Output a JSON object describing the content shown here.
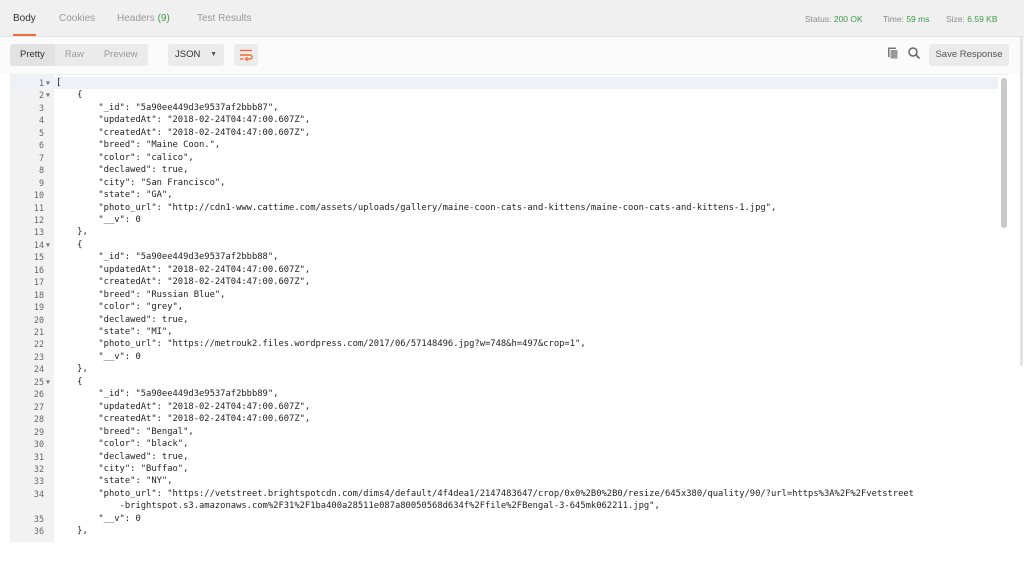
{
  "tabs": [
    {
      "label": "Body",
      "active": true
    },
    {
      "label": "Cookies",
      "active": false
    },
    {
      "label": "Headers",
      "count": "(9)",
      "active": false
    },
    {
      "label": "Test Results",
      "active": false
    }
  ],
  "status": {
    "status_label": "Status:",
    "status_value": "200 OK",
    "time_label": "Time:",
    "time_value": "59 ms",
    "size_label": "Size:",
    "size_value": "6.59 KB",
    "value_color": "#3f9b48"
  },
  "toolbar": {
    "view_modes": [
      "Pretty",
      "Raw",
      "Preview"
    ],
    "active_mode": "Pretty",
    "format_select": "JSON",
    "save_response_label": "Save Response",
    "accent_color": "#f26b3a"
  },
  "code_lines": [
    {
      "n": "1",
      "fold": true,
      "text": "["
    },
    {
      "n": "2",
      "fold": true,
      "text": "    {"
    },
    {
      "n": "3",
      "text": "        \"_id\": \"5a90ee449d3e9537af2bbb87\","
    },
    {
      "n": "4",
      "text": "        \"updatedAt\": \"2018-02-24T04:47:00.607Z\","
    },
    {
      "n": "5",
      "text": "        \"createdAt\": \"2018-02-24T04:47:00.607Z\","
    },
    {
      "n": "6",
      "text": "        \"breed\": \"Maine Coon.\","
    },
    {
      "n": "7",
      "text": "        \"color\": \"calico\","
    },
    {
      "n": "8",
      "text": "        \"declawed\": true,"
    },
    {
      "n": "9",
      "text": "        \"city\": \"San Francisco\","
    },
    {
      "n": "10",
      "text": "        \"state\": \"GA\","
    },
    {
      "n": "11",
      "text": "        \"photo_url\": \"http://cdn1-www.cattime.com/assets/uploads/gallery/maine-coon-cats-and-kittens/maine-coon-cats-and-kittens-1.jpg\","
    },
    {
      "n": "12",
      "text": "        \"__v\": 0"
    },
    {
      "n": "13",
      "text": "    },"
    },
    {
      "n": "14",
      "fold": true,
      "text": "    {"
    },
    {
      "n": "15",
      "text": "        \"_id\": \"5a90ee449d3e9537af2bbb88\","
    },
    {
      "n": "16",
      "text": "        \"updatedAt\": \"2018-02-24T04:47:00.607Z\","
    },
    {
      "n": "17",
      "text": "        \"createdAt\": \"2018-02-24T04:47:00.607Z\","
    },
    {
      "n": "18",
      "text": "        \"breed\": \"Russian Blue\","
    },
    {
      "n": "19",
      "text": "        \"color\": \"grey\","
    },
    {
      "n": "20",
      "text": "        \"declawed\": true,"
    },
    {
      "n": "21",
      "text": "        \"state\": \"MI\","
    },
    {
      "n": "22",
      "text": "        \"photo_url\": \"https://metrouk2.files.wordpress.com/2017/06/57148496.jpg?w=748&h=497&crop=1\","
    },
    {
      "n": "23",
      "text": "        \"__v\": 0"
    },
    {
      "n": "24",
      "text": "    },"
    },
    {
      "n": "25",
      "fold": true,
      "text": "    {"
    },
    {
      "n": "26",
      "text": "        \"_id\": \"5a90ee449d3e9537af2bbb89\","
    },
    {
      "n": "27",
      "text": "        \"updatedAt\": \"2018-02-24T04:47:00.607Z\","
    },
    {
      "n": "28",
      "text": "        \"createdAt\": \"2018-02-24T04:47:00.607Z\","
    },
    {
      "n": "29",
      "text": "        \"breed\": \"Bengal\","
    },
    {
      "n": "30",
      "text": "        \"color\": \"black\","
    },
    {
      "n": "31",
      "text": "        \"declawed\": true,"
    },
    {
      "n": "32",
      "text": "        \"city\": \"Buffao\","
    },
    {
      "n": "33",
      "text": "        \"state\": \"NY\","
    },
    {
      "n": "34",
      "text": "        \"photo_url\": \"https://vetstreet.brightspotcdn.com/dims4/default/4f4dea1/2147483647/crop/0x0%2B0%2B0/resize/645x380/quality/90/?url=https%3A%2F%2Fvetstreet"
    },
    {
      "n": "",
      "text": "            -brightspot.s3.amazonaws.com%2F31%2F1ba400a28511e087a80050568d634f%2Ffile%2FBengal-3-645mk062211.jpg\","
    },
    {
      "n": "35",
      "text": "        \"__v\": 0"
    },
    {
      "n": "36",
      "text": "    },"
    }
  ],
  "icons": {
    "wrap": "wrap-lines-icon",
    "copy": "copy-icon",
    "search": "search-icon"
  }
}
